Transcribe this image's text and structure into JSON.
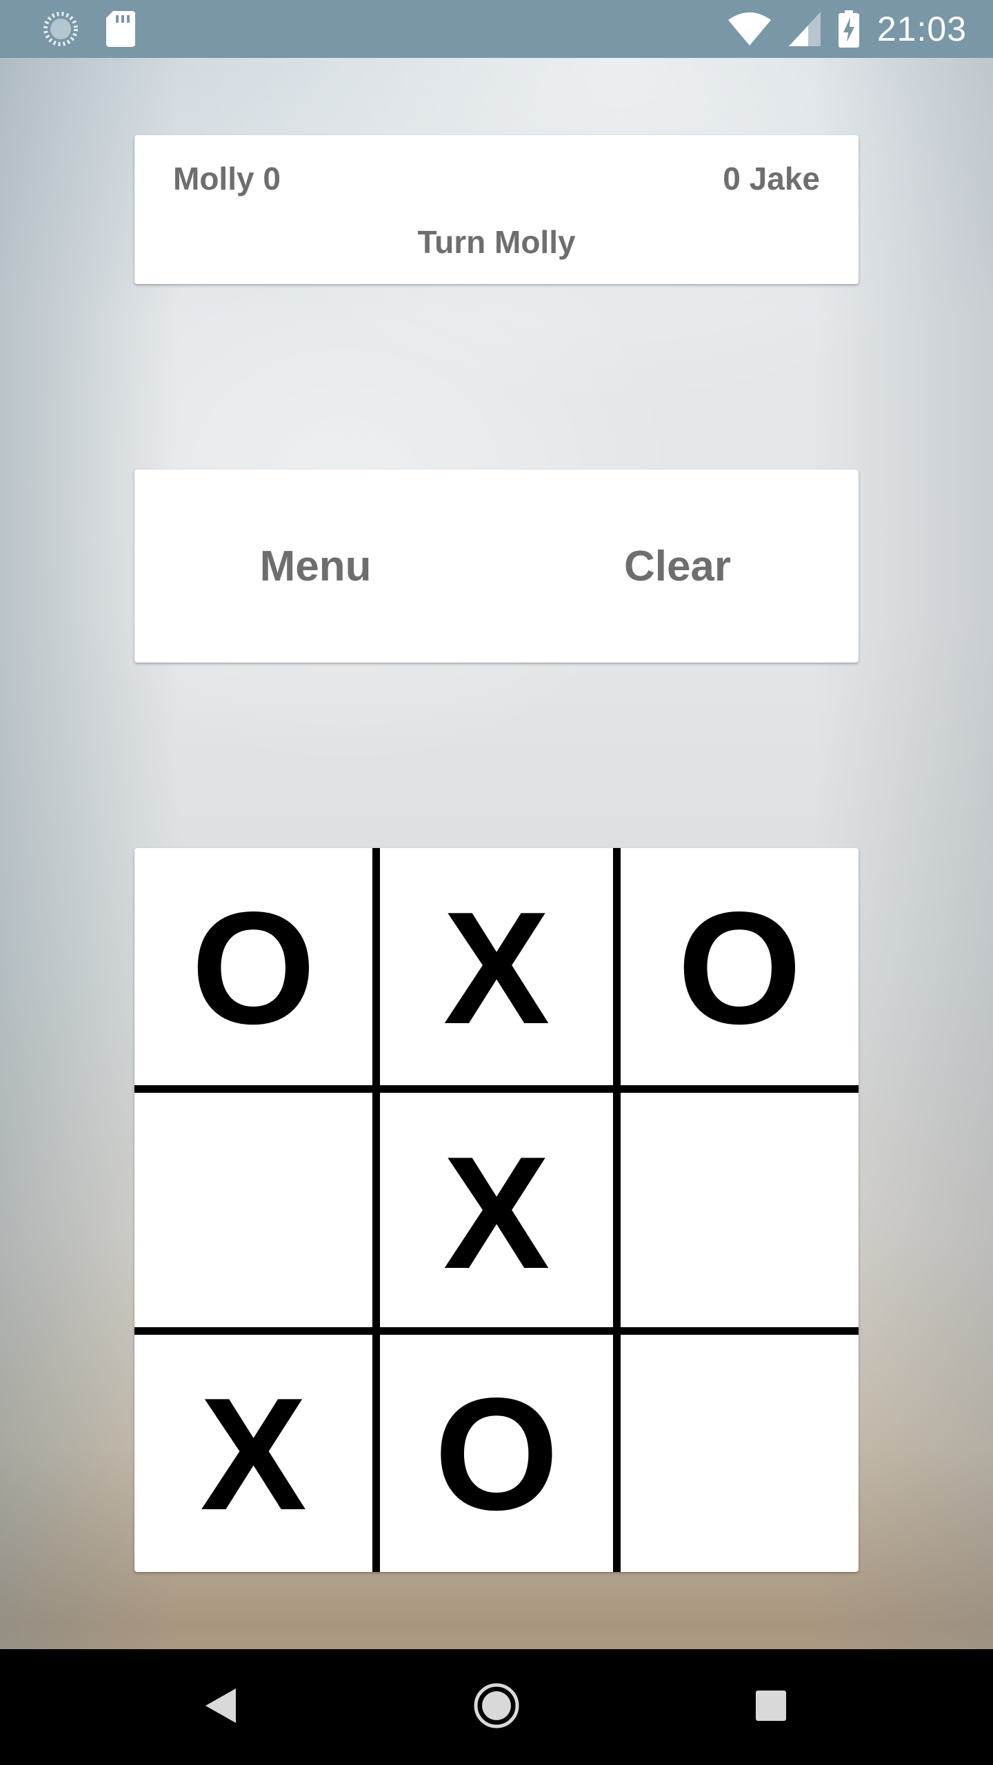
{
  "status_bar": {
    "time": "21:03",
    "icons": [
      "sync-icon",
      "sd-card-icon",
      "wifi-icon",
      "signal-icon",
      "battery-charging-icon"
    ]
  },
  "score": {
    "player1": "Molly 0",
    "player2": "0 Jake",
    "turn": "Turn Molly"
  },
  "actions": {
    "menu_label": "Menu",
    "clear_label": "Clear"
  },
  "board": {
    "cells": [
      "O",
      "X",
      "O",
      "",
      "X",
      "",
      "X",
      "O",
      ""
    ]
  },
  "nav_bar": {
    "icons": [
      "back-icon",
      "home-icon",
      "recents-icon"
    ]
  },
  "colors": {
    "status_bar": "#7997a6",
    "card": "#ffffff",
    "label_text": "#6e6e6e",
    "board_marks": "#000000",
    "nav_bar": "#000000"
  }
}
